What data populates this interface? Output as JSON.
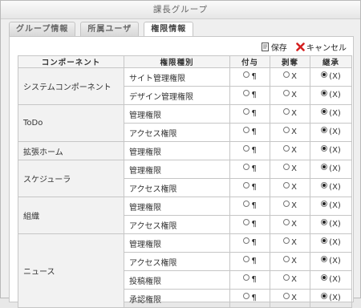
{
  "window": {
    "title": "課長グループ"
  },
  "tabs": [
    {
      "label": "グループ情報"
    },
    {
      "label": "所属ユーザ"
    },
    {
      "label": "権限情報"
    }
  ],
  "actions": {
    "save_label": "保存",
    "cancel_label": "キャンセル",
    "save_icon": "save-document-icon",
    "cancel_icon": "red-x-icon"
  },
  "table": {
    "headers": [
      "コンポーネント",
      "権限種別",
      "付与",
      "剥奪",
      "継承"
    ],
    "radio_labels": {
      "grant": "¶",
      "revoke": "X",
      "inherit": "(X)"
    },
    "groups": [
      {
        "component": "システムコンポーネント",
        "rows": [
          "サイト管理権限",
          "デザイン管理権限"
        ]
      },
      {
        "component": "ToDo",
        "rows": [
          "管理権限",
          "アクセス権限"
        ]
      },
      {
        "component": "拡張ホーム",
        "rows": [
          "管理権限"
        ]
      },
      {
        "component": "スケジューラ",
        "rows": [
          "管理権限",
          "アクセス権限"
        ]
      },
      {
        "component": "組織",
        "rows": [
          "管理権限",
          "アクセス権限"
        ]
      },
      {
        "component": "ニュース",
        "rows": [
          "管理権限",
          "アクセス権限",
          "投稿権限",
          "承認権限"
        ]
      }
    ],
    "selected": "inherit"
  }
}
